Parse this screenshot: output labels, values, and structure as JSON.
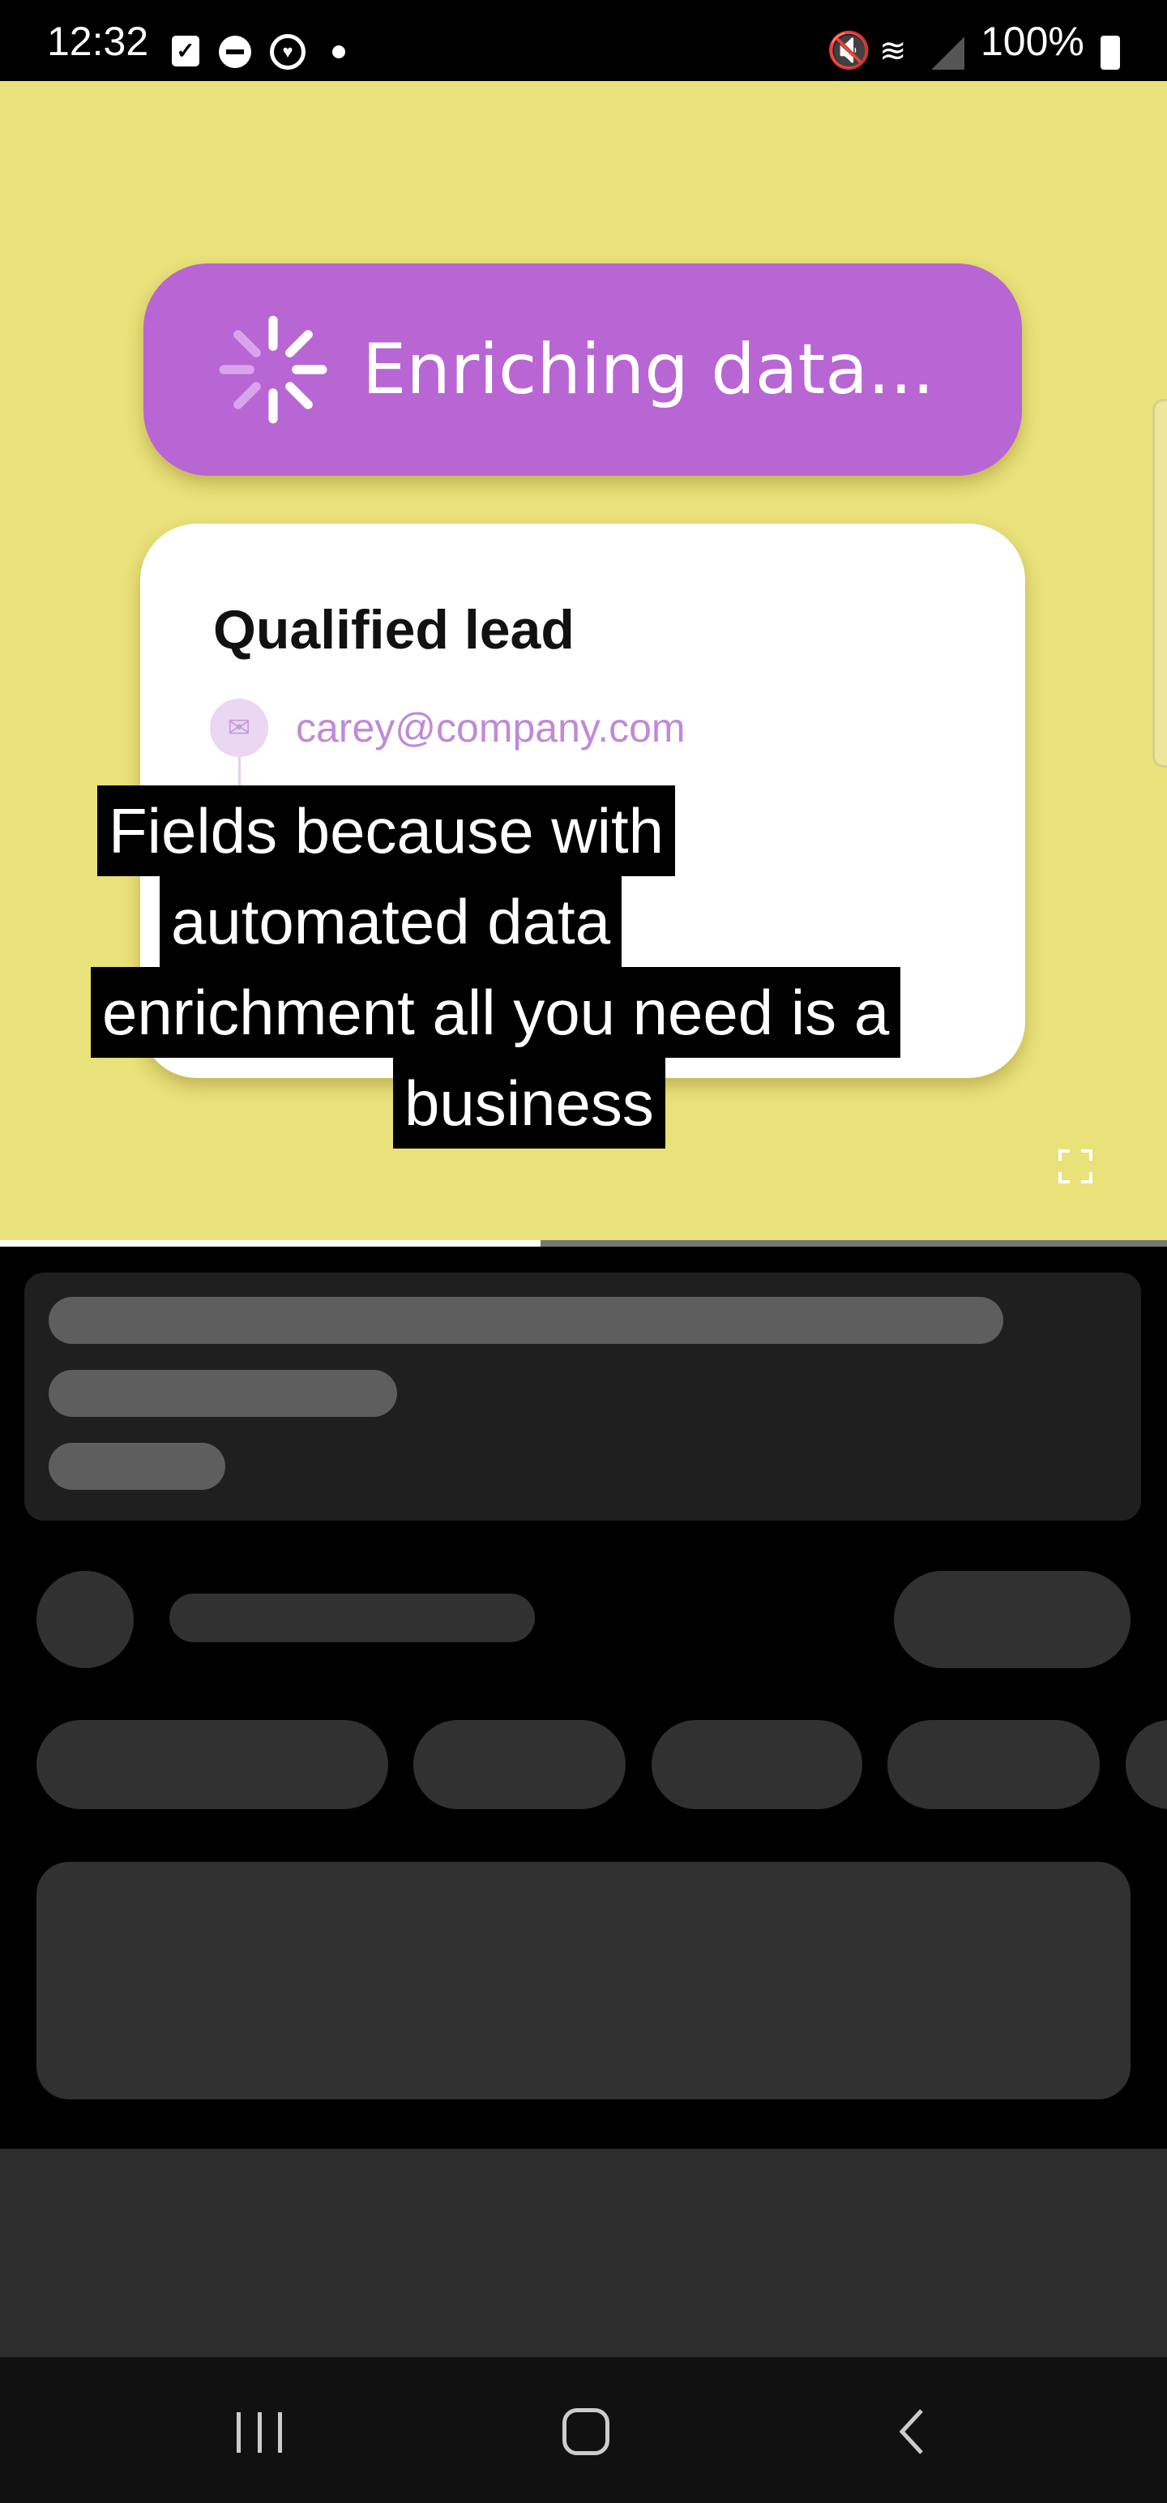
{
  "status_bar": {
    "time": "12:32",
    "battery": "100%",
    "icons": [
      "checkbox-icon",
      "dnd-icon",
      "heart-sync-icon",
      "dot-icon",
      "mute-icon",
      "wifi-6e-icon",
      "signal-icon",
      "battery-icon"
    ]
  },
  "video": {
    "banner": "Enriching data...",
    "card_title": "Qualified lead",
    "email": "carey@company.com",
    "captions": [
      "Fields because with",
      "automated data",
      "enrichment all you need is a",
      "business"
    ],
    "progress_fraction": 0.463
  },
  "colors": {
    "video_bg": "#e9e17a",
    "banner": "#b866d3",
    "email": "#c08ad8"
  }
}
